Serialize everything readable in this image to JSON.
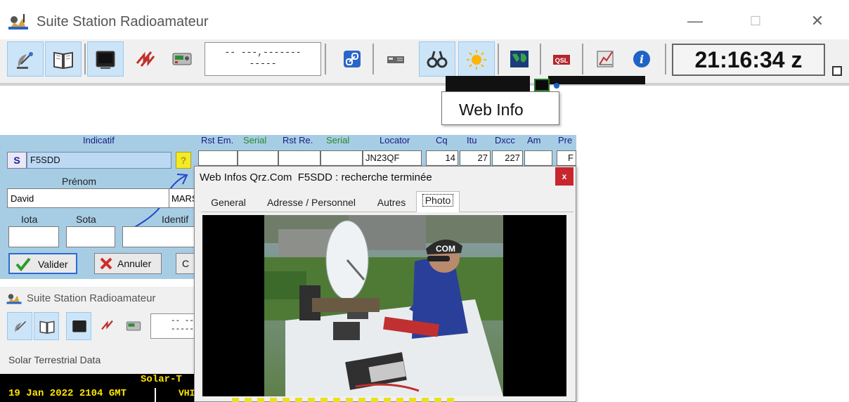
{
  "main_window": {
    "title": "Suite Station Radioamateur",
    "controls": {
      "minimize": "—",
      "maximize": "☐",
      "close": "✕"
    }
  },
  "toolbar": {
    "locator_line1": "-- ---,-------",
    "locator_line2": "-----",
    "clock": "21:16:34 z",
    "buttons": [
      "satellite-dish-icon",
      "book-icon",
      "terminal-icon",
      "zigzag-signal-icon",
      "radio-icon",
      "link-icon",
      "transceiver-icon",
      "binoculars-icon",
      "sun-icon",
      "world-map-icon",
      "qsl-card-icon",
      "chart-icon",
      "info-icon"
    ]
  },
  "tooltip": {
    "text": "Web Info"
  },
  "log_form": {
    "header_indicatif": "Indicatif",
    "header_cells": [
      "Rst Em.",
      "Serial",
      "Rst Re.",
      "Serial",
      "Locator",
      "Cq",
      "Itu",
      "Dxcc",
      "Am",
      "Pre"
    ],
    "s_button": "S",
    "callsign": "F5SDD",
    "qrz_button": "?",
    "prenom_label": "Prénom",
    "prenom_value": "David",
    "second_field_value": "MARS",
    "iota_label": "Iota",
    "sota_label": "Sota",
    "identif_label": "Identif",
    "valider_label": "Valider",
    "annuler_label": "Annuler",
    "cut_button_label": "C",
    "locator_value": "JN23QF",
    "cq_value": "14",
    "itu_value": "27",
    "dxcc_value": "227",
    "pre_value": "F"
  },
  "mini_window": {
    "title": "Suite Station Radioamateur",
    "locator_dashes": "-- ---,\n-----"
  },
  "solar": {
    "label": "Solar Terrestrial Data",
    "header": "Solar-T",
    "date": "19 Jan 2022 2104 GMT",
    "vhf": "VHI"
  },
  "popup": {
    "title": "Web Infos Qrz.Com  F5SDD : recherche terminée",
    "close": "x",
    "tabs": [
      "General",
      "Adresse / Personnel",
      "Autres",
      "Photo"
    ],
    "active_tab": "Photo",
    "photo_cap_text": "COM"
  },
  "colors": {
    "panel_blue": "#a7cde4",
    "toolbar_bg": "#f0f0f0",
    "close_red": "#c8262e",
    "solar_yellow": "#ffe600"
  }
}
